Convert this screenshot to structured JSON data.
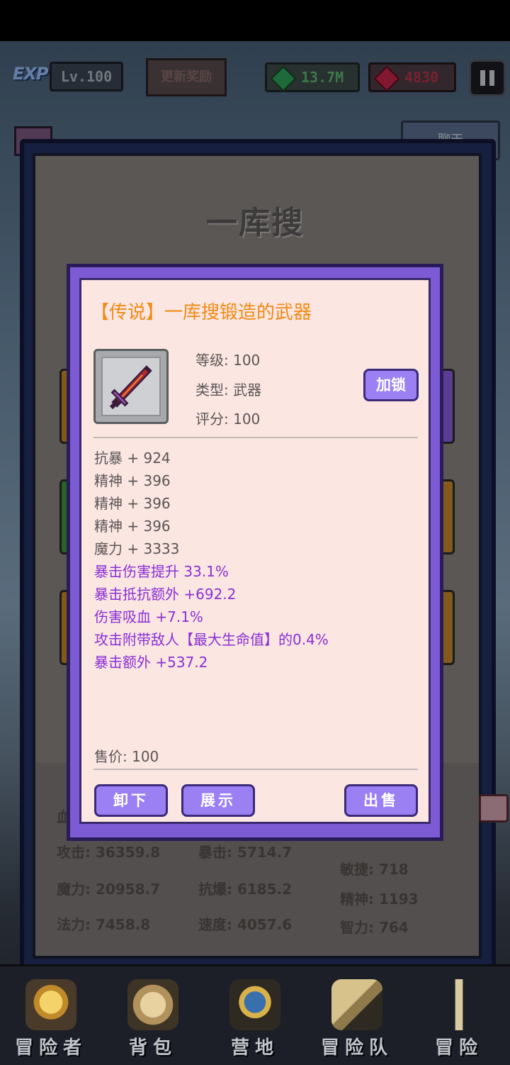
{
  "topbar": {
    "exp_label": "EXP",
    "level": "Lv.100",
    "update_reward": "更新奖励",
    "emerald": "13.7M",
    "ruby": "4830"
  },
  "panel": {
    "chat_label": "聊天",
    "character_name": "一库搜",
    "stats": {
      "hp_label": "血",
      "attack": "攻击: 36359.8",
      "crit": "暴击: 5714.7",
      "magic": "魔力: 20958.7",
      "crit_resist": "抗爆: 6185.2",
      "spell": "法力: 7458.8",
      "speed": "速度: 4057.6",
      "agility": "敏捷: 718",
      "spirit": "精神: 1193",
      "intellect": "智力: 764"
    }
  },
  "dialog": {
    "title": "【传说】一库搜锻造的武器",
    "level": "等级: 100",
    "type": "类型: 武器",
    "score": "评分: 100",
    "lock_label": "加锁",
    "base_attrs": [
      "抗暴 + 924",
      "精神 + 396",
      "精神 + 396",
      "精神 + 396",
      "魔力 + 3333"
    ],
    "extra_attrs": [
      "暴击伤害提升 33.1%",
      "暴击抵抗额外 +692.2",
      "伤害吸血 +7.1%",
      "攻击附带敌人【最大生命值】的0.4%",
      "暴击额外 +537.2"
    ],
    "price": "售价: 100",
    "unequip_label": "卸下",
    "show_label": "展示",
    "sell_label": "出售"
  },
  "nav": [
    {
      "label": "冒险者",
      "icon": "crown-helmet-icon"
    },
    {
      "label": "背包",
      "icon": "backpack-icon"
    },
    {
      "label": "营地",
      "icon": "camp-banner-icon"
    },
    {
      "label": "冒险队",
      "icon": "team-book-icon"
    },
    {
      "label": "冒险",
      "icon": "sword-icon"
    }
  ],
  "colors": {
    "legend_orange": "#f08a16",
    "extra_purple": "#8a2fd6",
    "button_purple": "#9b80f4",
    "dialog_frame": "#7c5bd4"
  }
}
